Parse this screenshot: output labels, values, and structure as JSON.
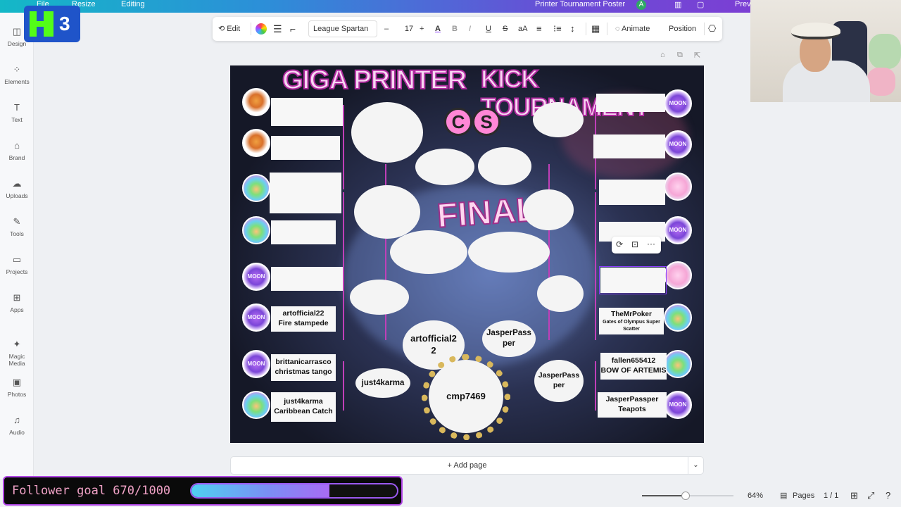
{
  "topbar": {
    "file": "File",
    "resize": "Resize",
    "editing": "Editing",
    "doc_title": "Printer Tournament Poster",
    "avatar_initial": "A",
    "preview": "Prev"
  },
  "kick_overlay": {
    "number": "3"
  },
  "sidebar": {
    "items": [
      {
        "label": "Design",
        "icon": "design-icon"
      },
      {
        "label": "Elements",
        "icon": "elements-icon"
      },
      {
        "label": "Text",
        "icon": "text-icon"
      },
      {
        "label": "Brand",
        "icon": "brand-icon"
      },
      {
        "label": "Uploads",
        "icon": "uploads-icon"
      },
      {
        "label": "Tools",
        "icon": "tools-icon"
      },
      {
        "label": "Projects",
        "icon": "projects-icon"
      },
      {
        "label": "Apps",
        "icon": "apps-icon"
      },
      {
        "label": "Magic Media",
        "icon": "magic-media-icon"
      },
      {
        "label": "Photos",
        "icon": "photos-icon"
      },
      {
        "label": "Audio",
        "icon": "audio-icon"
      }
    ]
  },
  "toolbar": {
    "edit": "Edit",
    "font": "League Spartan",
    "font_size": "17",
    "minus": "–",
    "plus": "+",
    "text_color_glyph": "A",
    "bold": "B",
    "italic": "I",
    "underline": "U",
    "strike": "S",
    "case": "aA",
    "animate": "Animate",
    "position": "Position"
  },
  "poster": {
    "title_left": "GIGA PRINTER",
    "title_right": "KICK TOURNAMENT",
    "final": "FINAL",
    "cs_left": "C",
    "cs_right": "S",
    "center_winner": "cmp7469",
    "semi_left": "artofficial2\n2",
    "semi_right": "JasperPass\nper",
    "qf_left": "just4karma",
    "qf_right": "JasperPass\nper",
    "left_slots": [
      {
        "name": "",
        "song": ""
      },
      {
        "name": "",
        "song": ""
      },
      {
        "name": "",
        "song": ""
      },
      {
        "name": "",
        "song": ""
      },
      {
        "name": "",
        "song": ""
      },
      {
        "name": "artofficial22",
        "song": "Fire stampede"
      },
      {
        "name": "brittanicarrasco",
        "song": "christmas tango"
      },
      {
        "name": "just4karma",
        "song": "Caribbean Catch"
      }
    ],
    "right_slots": [
      {
        "name": "",
        "song": ""
      },
      {
        "name": "",
        "song": ""
      },
      {
        "name": "",
        "song": ""
      },
      {
        "name": "",
        "song": ""
      },
      {
        "name": "",
        "song": ""
      },
      {
        "name": "TheMrPoker",
        "song": "Gates of Olympus Super Scatter"
      },
      {
        "name": "fallen655412",
        "song": "BOW OF ARTEMIS"
      },
      {
        "name": "JasperPassper",
        "song": "Teapots"
      }
    ]
  },
  "add_page": "+ Add page",
  "status": {
    "zoom": "64%",
    "pages": "Pages",
    "page_count": "1 / 1",
    "zoom_fraction": 0.48
  },
  "goal": {
    "text": "Follower goal 670/1000",
    "current": 670,
    "target": 1000
  },
  "colors": {
    "accent": "#8b3dff",
    "goal_border": "#b146e6",
    "bracket": "#c03fb8"
  }
}
